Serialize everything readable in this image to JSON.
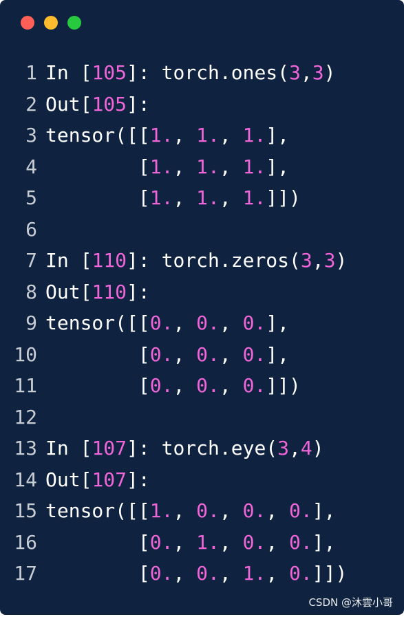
{
  "window_controls": [
    {
      "name": "close",
      "color": "#ff5f56"
    },
    {
      "name": "minimize",
      "color": "#ffbd2e"
    },
    {
      "name": "maximize",
      "color": "#27c93f"
    }
  ],
  "colors": {
    "background": "#0f2340",
    "text": "#ffffff",
    "number": "#f065d8",
    "line_number": "#c8ccd3"
  },
  "lines": [
    {
      "n": "1",
      "tokens": [
        {
          "t": "In [",
          "k": "plain"
        },
        {
          "t": "105",
          "k": "num"
        },
        {
          "t": "]: torch.ones(",
          "k": "plain"
        },
        {
          "t": "3",
          "k": "num"
        },
        {
          "t": ",",
          "k": "plain"
        },
        {
          "t": "3",
          "k": "num"
        },
        {
          "t": ")",
          "k": "plain"
        }
      ]
    },
    {
      "n": "2",
      "tokens": [
        {
          "t": "Out[",
          "k": "plain"
        },
        {
          "t": "105",
          "k": "num"
        },
        {
          "t": "]:",
          "k": "plain"
        }
      ]
    },
    {
      "n": "3",
      "tokens": [
        {
          "t": "tensor([[",
          "k": "plain"
        },
        {
          "t": "1.",
          "k": "num"
        },
        {
          "t": ", ",
          "k": "plain"
        },
        {
          "t": "1.",
          "k": "num"
        },
        {
          "t": ", ",
          "k": "plain"
        },
        {
          "t": "1.",
          "k": "num"
        },
        {
          "t": "],",
          "k": "plain"
        }
      ]
    },
    {
      "n": "4",
      "tokens": [
        {
          "t": "        [",
          "k": "plain"
        },
        {
          "t": "1.",
          "k": "num"
        },
        {
          "t": ", ",
          "k": "plain"
        },
        {
          "t": "1.",
          "k": "num"
        },
        {
          "t": ", ",
          "k": "plain"
        },
        {
          "t": "1.",
          "k": "num"
        },
        {
          "t": "],",
          "k": "plain"
        }
      ]
    },
    {
      "n": "5",
      "tokens": [
        {
          "t": "        [",
          "k": "plain"
        },
        {
          "t": "1.",
          "k": "num"
        },
        {
          "t": ", ",
          "k": "plain"
        },
        {
          "t": "1.",
          "k": "num"
        },
        {
          "t": ", ",
          "k": "plain"
        },
        {
          "t": "1.",
          "k": "num"
        },
        {
          "t": "]])",
          "k": "plain"
        }
      ]
    },
    {
      "n": "6",
      "tokens": []
    },
    {
      "n": "7",
      "tokens": [
        {
          "t": "In [",
          "k": "plain"
        },
        {
          "t": "110",
          "k": "num"
        },
        {
          "t": "]: torch.zeros(",
          "k": "plain"
        },
        {
          "t": "3",
          "k": "num"
        },
        {
          "t": ",",
          "k": "plain"
        },
        {
          "t": "3",
          "k": "num"
        },
        {
          "t": ")",
          "k": "plain"
        }
      ]
    },
    {
      "n": "8",
      "tokens": [
        {
          "t": "Out[",
          "k": "plain"
        },
        {
          "t": "110",
          "k": "num"
        },
        {
          "t": "]:",
          "k": "plain"
        }
      ]
    },
    {
      "n": "9",
      "tokens": [
        {
          "t": "tensor([[",
          "k": "plain"
        },
        {
          "t": "0.",
          "k": "num"
        },
        {
          "t": ", ",
          "k": "plain"
        },
        {
          "t": "0.",
          "k": "num"
        },
        {
          "t": ", ",
          "k": "plain"
        },
        {
          "t": "0.",
          "k": "num"
        },
        {
          "t": "],",
          "k": "plain"
        }
      ]
    },
    {
      "n": "10",
      "tokens": [
        {
          "t": "        [",
          "k": "plain"
        },
        {
          "t": "0.",
          "k": "num"
        },
        {
          "t": ", ",
          "k": "plain"
        },
        {
          "t": "0.",
          "k": "num"
        },
        {
          "t": ", ",
          "k": "plain"
        },
        {
          "t": "0.",
          "k": "num"
        },
        {
          "t": "],",
          "k": "plain"
        }
      ]
    },
    {
      "n": "11",
      "tokens": [
        {
          "t": "        [",
          "k": "plain"
        },
        {
          "t": "0.",
          "k": "num"
        },
        {
          "t": ", ",
          "k": "plain"
        },
        {
          "t": "0.",
          "k": "num"
        },
        {
          "t": ", ",
          "k": "plain"
        },
        {
          "t": "0.",
          "k": "num"
        },
        {
          "t": "]])",
          "k": "plain"
        }
      ]
    },
    {
      "n": "12",
      "tokens": []
    },
    {
      "n": "13",
      "tokens": [
        {
          "t": "In [",
          "k": "plain"
        },
        {
          "t": "107",
          "k": "num"
        },
        {
          "t": "]: torch.eye(",
          "k": "plain"
        },
        {
          "t": "3",
          "k": "num"
        },
        {
          "t": ",",
          "k": "plain"
        },
        {
          "t": "4",
          "k": "num"
        },
        {
          "t": ")",
          "k": "plain"
        }
      ]
    },
    {
      "n": "14",
      "tokens": [
        {
          "t": "Out[",
          "k": "plain"
        },
        {
          "t": "107",
          "k": "num"
        },
        {
          "t": "]:",
          "k": "plain"
        }
      ]
    },
    {
      "n": "15",
      "tokens": [
        {
          "t": "tensor([[",
          "k": "plain"
        },
        {
          "t": "1.",
          "k": "num"
        },
        {
          "t": ", ",
          "k": "plain"
        },
        {
          "t": "0.",
          "k": "num"
        },
        {
          "t": ", ",
          "k": "plain"
        },
        {
          "t": "0.",
          "k": "num"
        },
        {
          "t": ", ",
          "k": "plain"
        },
        {
          "t": "0.",
          "k": "num"
        },
        {
          "t": "],",
          "k": "plain"
        }
      ]
    },
    {
      "n": "16",
      "tokens": [
        {
          "t": "        [",
          "k": "plain"
        },
        {
          "t": "0.",
          "k": "num"
        },
        {
          "t": ", ",
          "k": "plain"
        },
        {
          "t": "1.",
          "k": "num"
        },
        {
          "t": ", ",
          "k": "plain"
        },
        {
          "t": "0.",
          "k": "num"
        },
        {
          "t": ", ",
          "k": "plain"
        },
        {
          "t": "0.",
          "k": "num"
        },
        {
          "t": "],",
          "k": "plain"
        }
      ]
    },
    {
      "n": "17",
      "tokens": [
        {
          "t": "        [",
          "k": "plain"
        },
        {
          "t": "0.",
          "k": "num"
        },
        {
          "t": ", ",
          "k": "plain"
        },
        {
          "t": "0.",
          "k": "num"
        },
        {
          "t": ", ",
          "k": "plain"
        },
        {
          "t": "1.",
          "k": "num"
        },
        {
          "t": ", ",
          "k": "plain"
        },
        {
          "t": "0.",
          "k": "num"
        },
        {
          "t": "]])",
          "k": "plain"
        }
      ]
    }
  ],
  "watermark": "CSDN @沐雲小哥"
}
